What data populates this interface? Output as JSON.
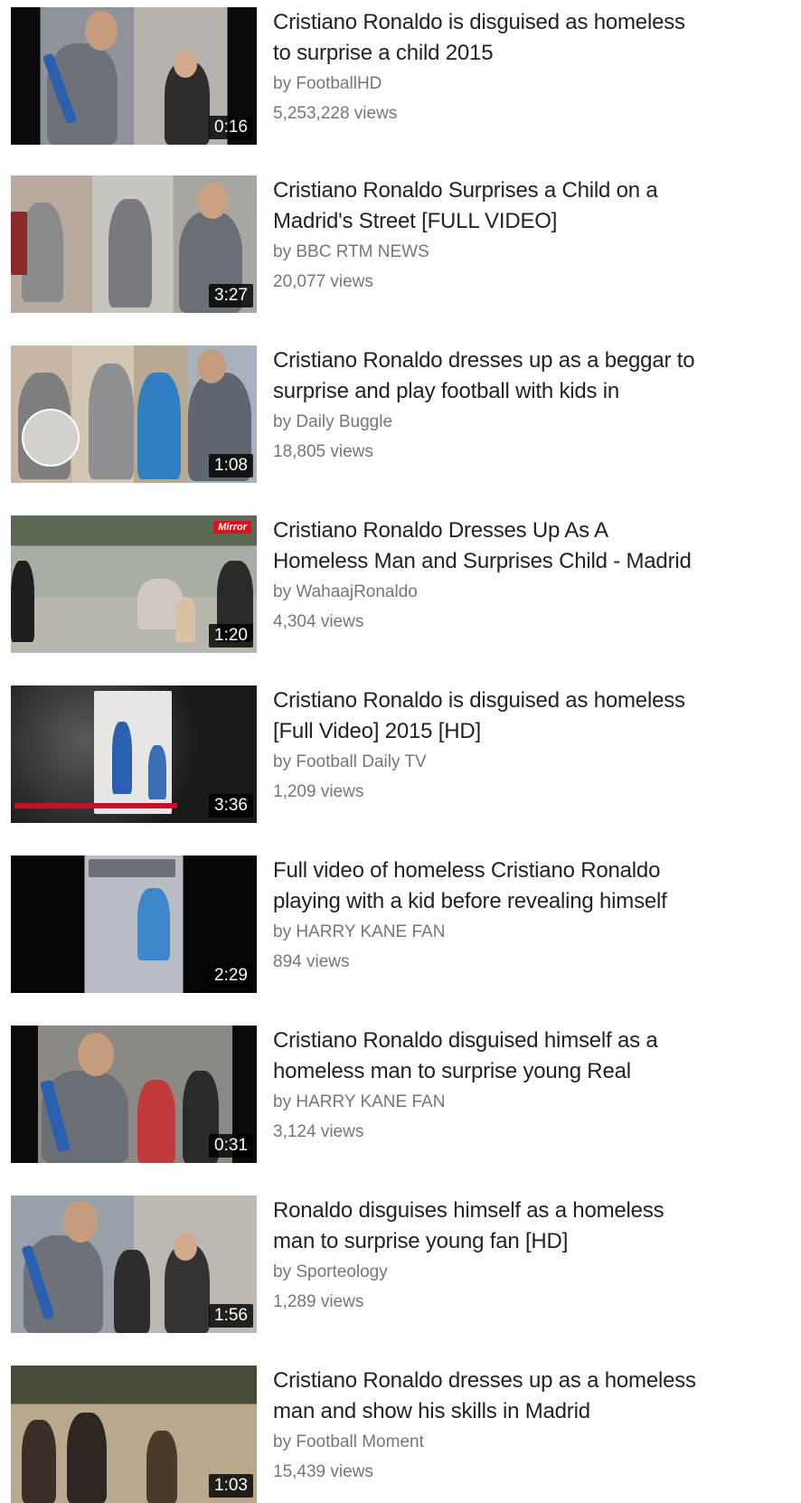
{
  "videos": [
    {
      "title_lines": [
        "Cristiano Ronaldo is disguised as homeless",
        "to surprise a child 2015"
      ],
      "channel": "by FootballHD",
      "views": "5,253,228 views",
      "duration": "0:16",
      "thumb_colors": {
        "bg": "#9aa0a8",
        "accent": "#2b5fb0"
      }
    },
    {
      "title_lines": [
        "Cristiano Ronaldo Surprises a Child on a",
        "Madrid's Street [FULL VIDEO]"
      ],
      "channel": "by BBC RTM NEWS",
      "views": "20,077 views",
      "duration": "3:27",
      "thumb_colors": {
        "bg": "#b9b4ae",
        "accent": "#8a2a2a"
      }
    },
    {
      "title_lines": [
        "Cristiano Ronaldo dresses up as a beggar to",
        "surprise and play football with kids in"
      ],
      "channel": "by Daily Buggle",
      "views": "18,805 views",
      "duration": "1:08",
      "thumb_colors": {
        "bg": "#c7b9a6",
        "accent": "#2f7fc2"
      }
    },
    {
      "title_lines": [
        "Cristiano Ronaldo Dresses Up As A",
        "Homeless Man and Surprises Child - Madrid"
      ],
      "channel": "by WahaajRonaldo",
      "views": "4,304 views",
      "duration": "1:20",
      "thumb_colors": {
        "bg": "#a3aa9e",
        "accent": "#d9141c"
      }
    },
    {
      "title_lines": [
        "Cristiano Ronaldo is disguised as homeless",
        "[Full Video] 2015 [HD]"
      ],
      "channel": "by Football Daily TV",
      "views": "1,209 views",
      "duration": "3:36",
      "thumb_colors": {
        "bg": "#3a3a3a",
        "accent": "#2b5fb0"
      }
    },
    {
      "title_lines": [
        "Full video of homeless Cristiano Ronaldo",
        "playing with a kid before revealing himself"
      ],
      "channel": "by HARRY KANE FAN",
      "views": "894 views",
      "duration": "2:29",
      "thumb_colors": {
        "bg": "#000000",
        "accent": "#3d86c9"
      }
    },
    {
      "title_lines": [
        "Cristiano Ronaldo disguised himself as a",
        "homeless man to surprise young Real"
      ],
      "channel": "by HARRY KANE FAN",
      "views": "3,124 views",
      "duration": "0:31",
      "thumb_colors": {
        "bg": "#8e8a85",
        "accent": "#2b5fb0"
      }
    },
    {
      "title_lines": [
        "Ronaldo disguises himself as a homeless",
        "man to surprise young fan [HD]"
      ],
      "channel": "by Sporteology",
      "views": "1,289 views",
      "duration": "1:56",
      "thumb_colors": {
        "bg": "#9aa0a8",
        "accent": "#2b5fb0"
      }
    },
    {
      "title_lines": [
        "Cristiano Ronaldo dresses up as a homeless",
        "man and show his skills in Madrid"
      ],
      "channel": "by Football Moment",
      "views": "15,439 views",
      "duration": "1:03",
      "thumb_colors": {
        "bg": "#b49a7a",
        "accent": "#4a3a2a"
      }
    }
  ],
  "badge_text": {
    "mirror": "Mirror"
  }
}
